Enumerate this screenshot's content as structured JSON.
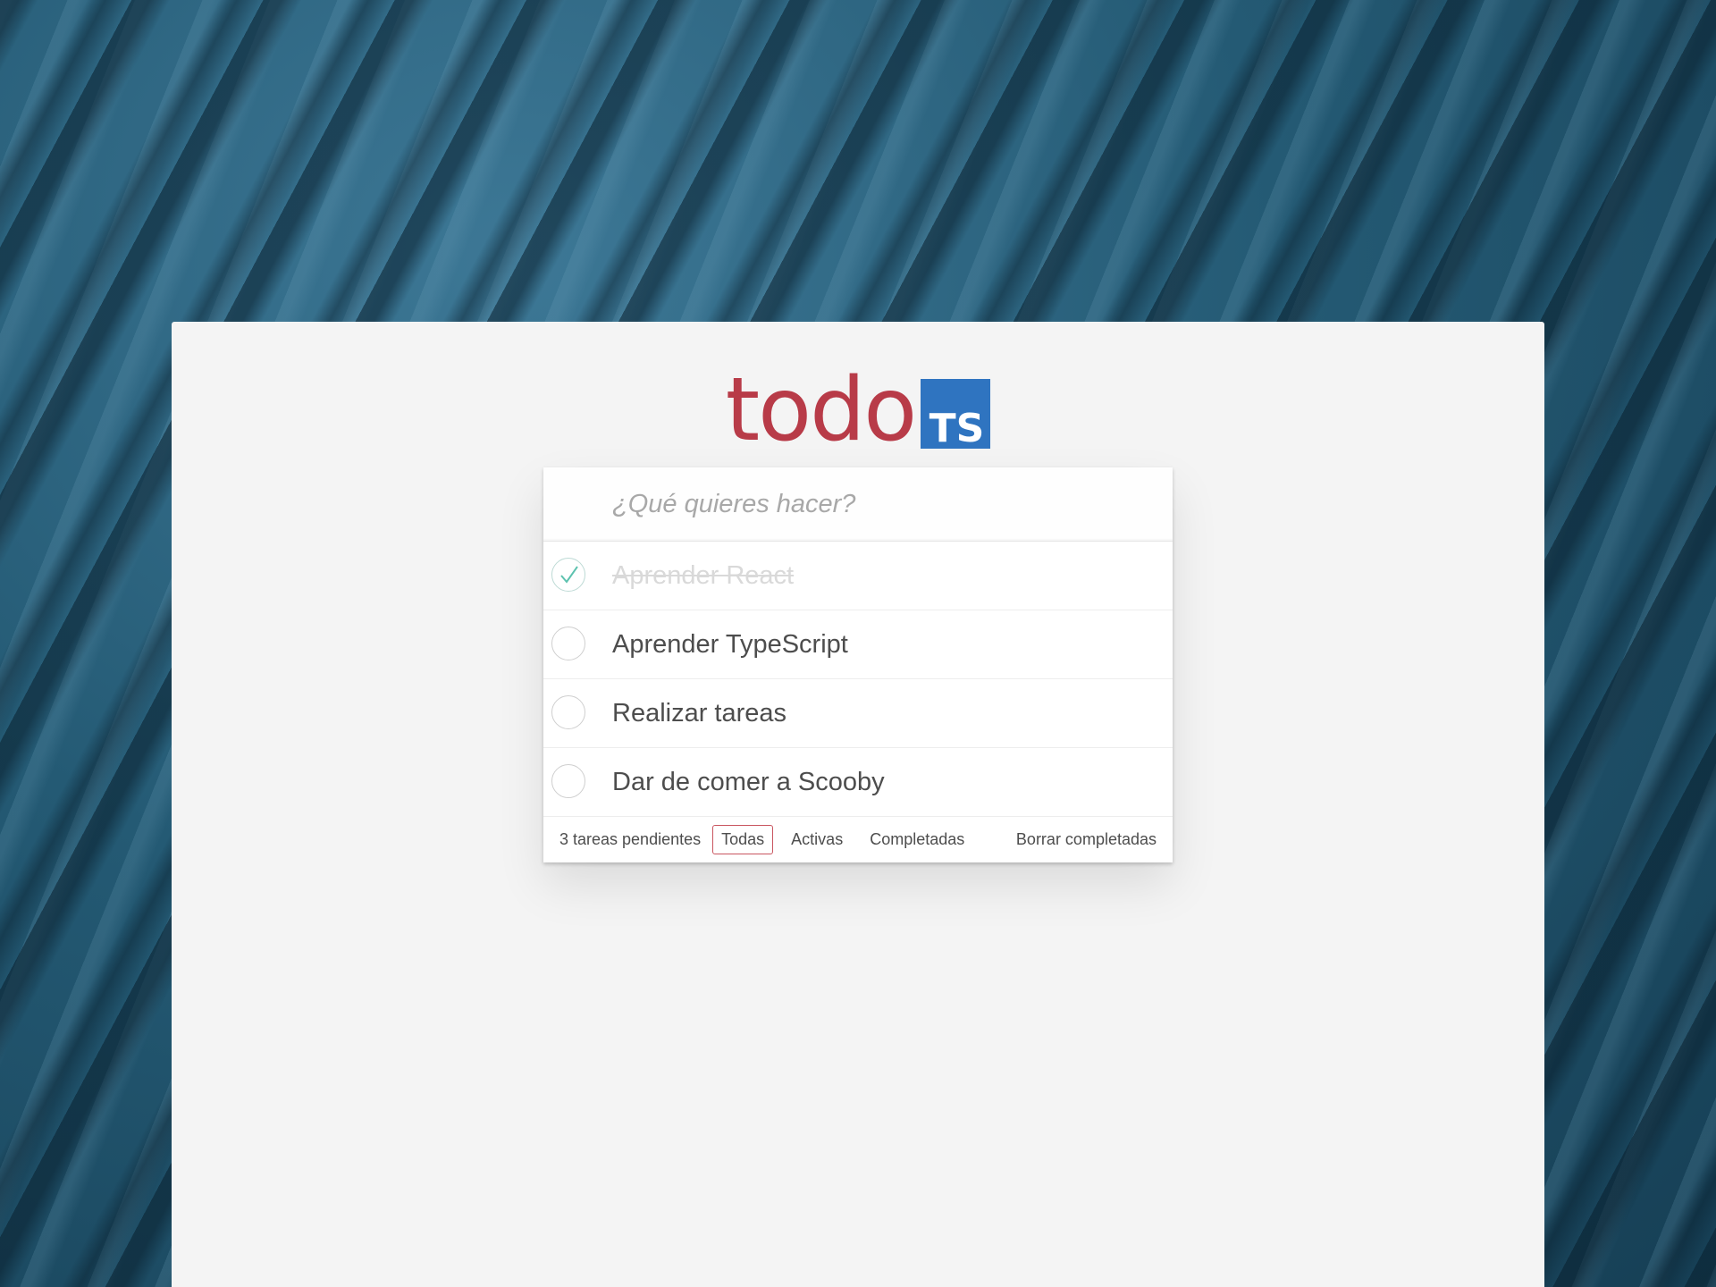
{
  "brand": {
    "word": "todo",
    "badge": "TS",
    "word_color": "#b83b48",
    "badge_color": "#2f74c0"
  },
  "new_todo": {
    "value": "",
    "placeholder": "¿Qué quieres hacer?"
  },
  "todos": [
    {
      "label": "Aprender React",
      "completed": true
    },
    {
      "label": "Aprender TypeScript",
      "completed": false
    },
    {
      "label": "Realizar tareas",
      "completed": false
    },
    {
      "label": "Dar de comer a Scooby",
      "completed": false
    }
  ],
  "footer": {
    "count_text": "3 tareas pendientes",
    "filters": [
      {
        "label": "Todas",
        "selected": true
      },
      {
        "label": "Activas",
        "selected": false
      },
      {
        "label": "Completadas",
        "selected": false
      }
    ],
    "clear_label": "Borrar completadas",
    "selected_border_color": "#c9555f"
  },
  "colors": {
    "check_color": "#5dc2af",
    "completed_text": "#d9d9d9",
    "panel_bg": "#f4f4f4"
  }
}
